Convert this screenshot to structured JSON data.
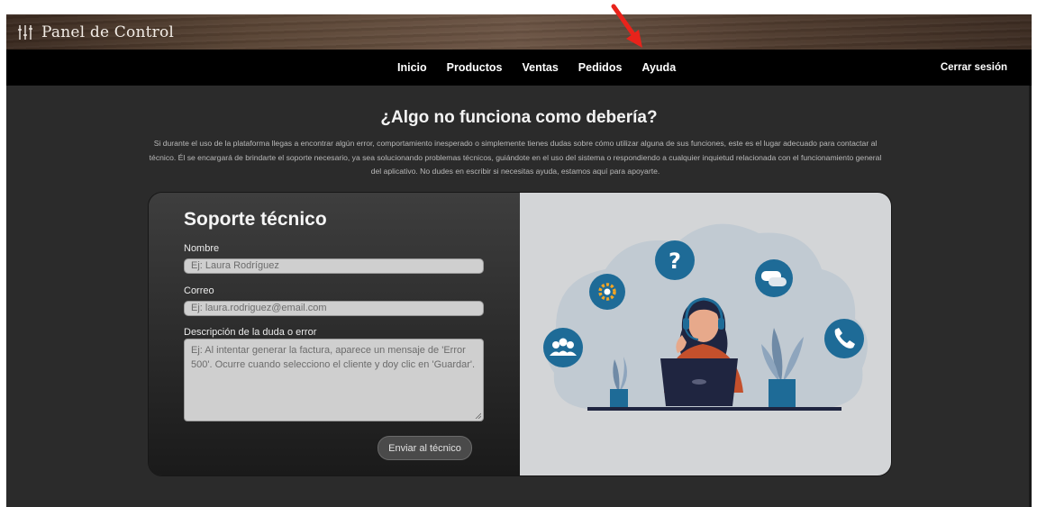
{
  "app": {
    "title": "Panel de Control",
    "logo_icon": "sliders-icon"
  },
  "nav": {
    "items": [
      {
        "label": "Inicio"
      },
      {
        "label": "Productos"
      },
      {
        "label": "Ventas"
      },
      {
        "label": "Pedidos"
      },
      {
        "label": "Ayuda"
      }
    ],
    "logout_label": "Cerrar sesión"
  },
  "hero": {
    "title": "¿Algo no funciona como debería?",
    "text": "Si durante el uso de la plataforma llegas a encontrar algún error, comportamiento inesperado o simplemente tienes dudas sobre cómo utilizar alguna de sus funciones, este es el lugar adecuado para contactar al técnico. Él se encargará de brindarte el soporte necesario, ya sea solucionando problemas técnicos, guiándote en el uso del sistema o respondiendo a cualquier inquietud relacionada con el funcionamiento general del aplicativo. No dudes en escribir si necesitas ayuda, estamos aquí para apoyarte."
  },
  "form": {
    "title": "Soporte técnico",
    "name_label": "Nombre",
    "name_placeholder": "Ej: Laura Rodríguez",
    "email_label": "Correo",
    "email_placeholder": "Ej: laura.rodriguez@email.com",
    "description_label": "Descripción de la duda o error",
    "description_placeholder": "Ej: Al intentar generar la factura, aparece un mensaje de 'Error 500'. Ocurre cuando selecciono el cliente y doy clic en 'Guardar'.",
    "submit_label": "Enviar al técnico"
  },
  "colors": {
    "annotation_arrow": "#e8231b",
    "illustration_blue": "#1e6b97",
    "agent_shirt": "#c4502c"
  }
}
